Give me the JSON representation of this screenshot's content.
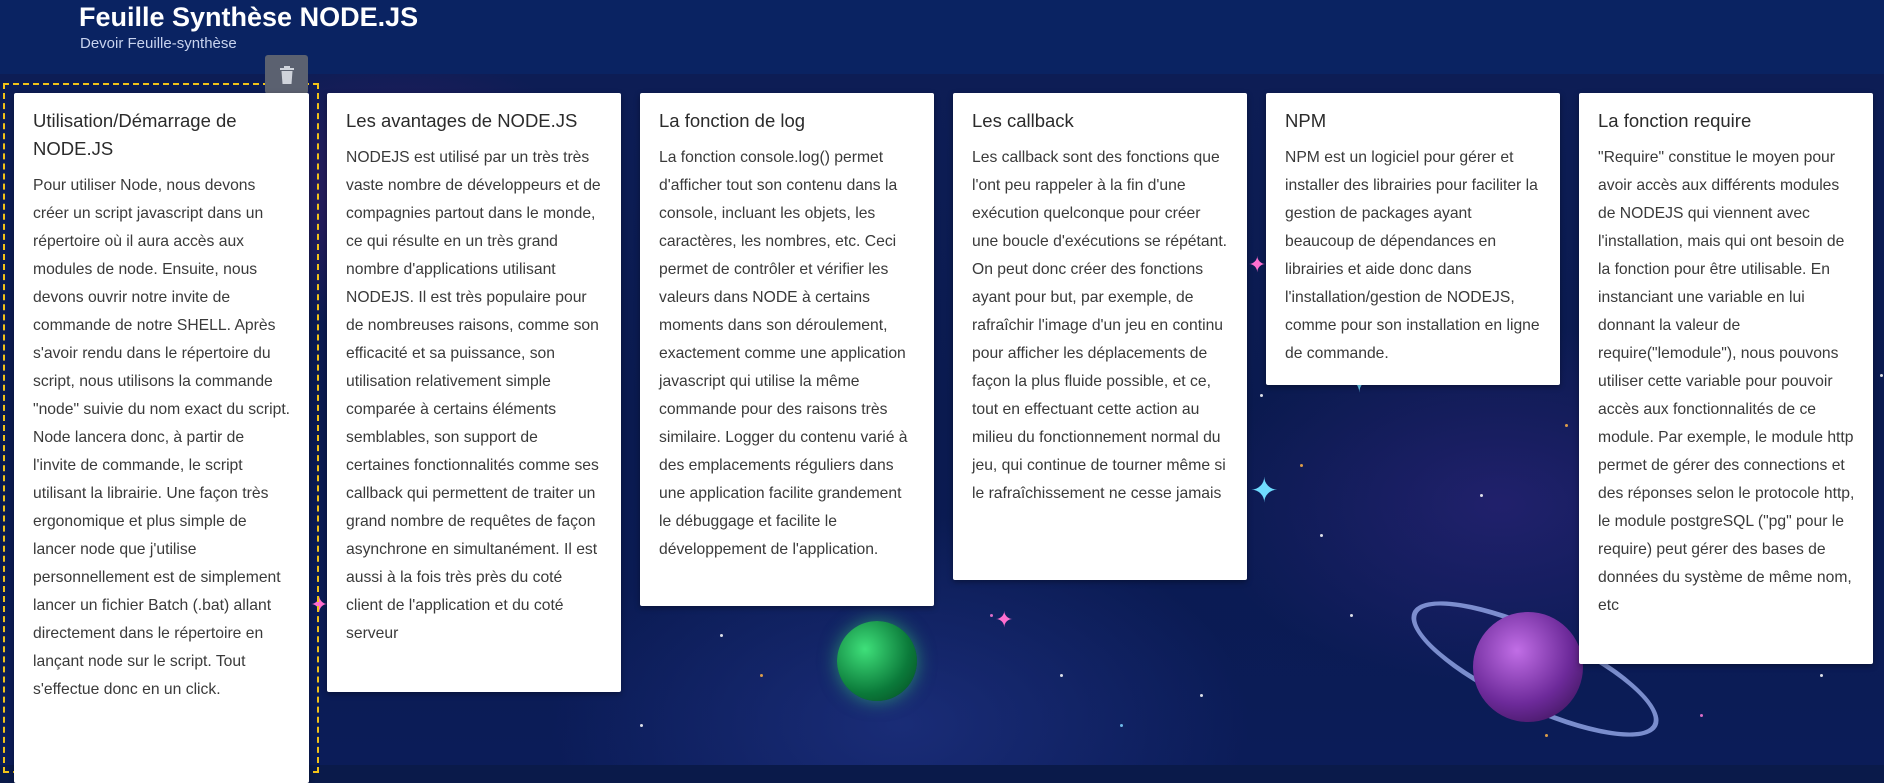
{
  "header": {
    "title": "Feuille Synthèse NODE.JS",
    "subtitle": "Devoir Feuille-synthèse"
  },
  "toolbar": {
    "delete_icon": "trash-icon"
  },
  "cards": [
    {
      "title": "Utilisation/Démarrage de NODE.JS",
      "body": "Pour utiliser Node, nous devons créer un script javascript dans un répertoire où il aura accès aux modules de node. Ensuite, nous devons ouvrir notre invite de commande de notre SHELL. Après s'avoir rendu dans le répertoire du script, nous utilisons la commande \"node\" suivie du nom exact du script. Node lancera donc, à partir de l'invite de commande, le script utilisant la librairie. Une façon très ergonomique et plus simple de lancer node que j'utilise personnellement est de simplement lancer un fichier Batch (.bat) allant directement dans le répertoire en lançant node sur le script. Tout s'effectue donc en un click."
    },
    {
      "title": "Les avantages de NODE.JS",
      "body": "NODEJS est utilisé par un très très vaste nombre de développeurs et de compagnies partout dans le monde, ce qui résulte en un très grand nombre d'applications utilisant NODEJS. Il est très populaire pour de nombreuses raisons, comme son efficacité et sa puissance, son utilisation relativement simple comparée à certains éléments semblables, son support de certaines fonctionnalités comme ses callback qui permettent de traiter un grand nombre de requêtes de façon asynchrone en simultanément. Il est aussi à la fois très près du coté client de l'application et du coté serveur"
    },
    {
      "title": "La fonction de log",
      "body": "La fonction console.log() permet d'afficher tout son contenu dans la console, incluant les objets, les caractères, les nombres, etc. Ceci permet de contrôler et vérifier les valeurs dans NODE à certains moments dans son déroulement, exactement comme une application javascript qui utilise la même commande pour des raisons très similaire. Logger du contenu varié à des emplacements réguliers dans une application facilite grandement le débuggage et facilite le développement de l'application."
    },
    {
      "title": "Les callback",
      "body": "Les callback sont des fonctions que l'ont peu rappeler à la fin d'une exécution quelconque pour créer une boucle d'exécutions se répétant. On peut donc créer des fonctions ayant pour but, par exemple, de rafraîchir l'image d'un jeu en continu pour afficher les déplacements de façon la plus fluide possible, et ce, tout en effectuant cette action au milieu du fonctionnement normal du jeu, qui continue de tourner même si le rafraîchissement ne cesse jamais"
    },
    {
      "title": "NPM",
      "body": "NPM est un logiciel pour gérer et installer des librairies pour faciliter la gestion de packages ayant beaucoup de dépendances en librairies et aide donc dans l'installation/gestion de NODEJS, comme pour son installation en ligne de commande."
    },
    {
      "title": "La fonction require",
      "body": "\"Require\" constitue le moyen pour avoir accès aux différents modules de NODEJS qui viennent avec l'installation, mais qui ont besoin de la fonction pour être utilisable. En instanciant une variable en lui donnant la valeur de require(\"lemodule\"), nous pouvons utiliser cette variable pour pouvoir accès aux fonctionnalités de ce module. Par exemple, le module http permet de gérer des connections et des réponses selon le protocole http, le module postgreSQL (\"pg\" pour le require) peut gérer des bases de données du système de même nom, etc"
    }
  ]
}
